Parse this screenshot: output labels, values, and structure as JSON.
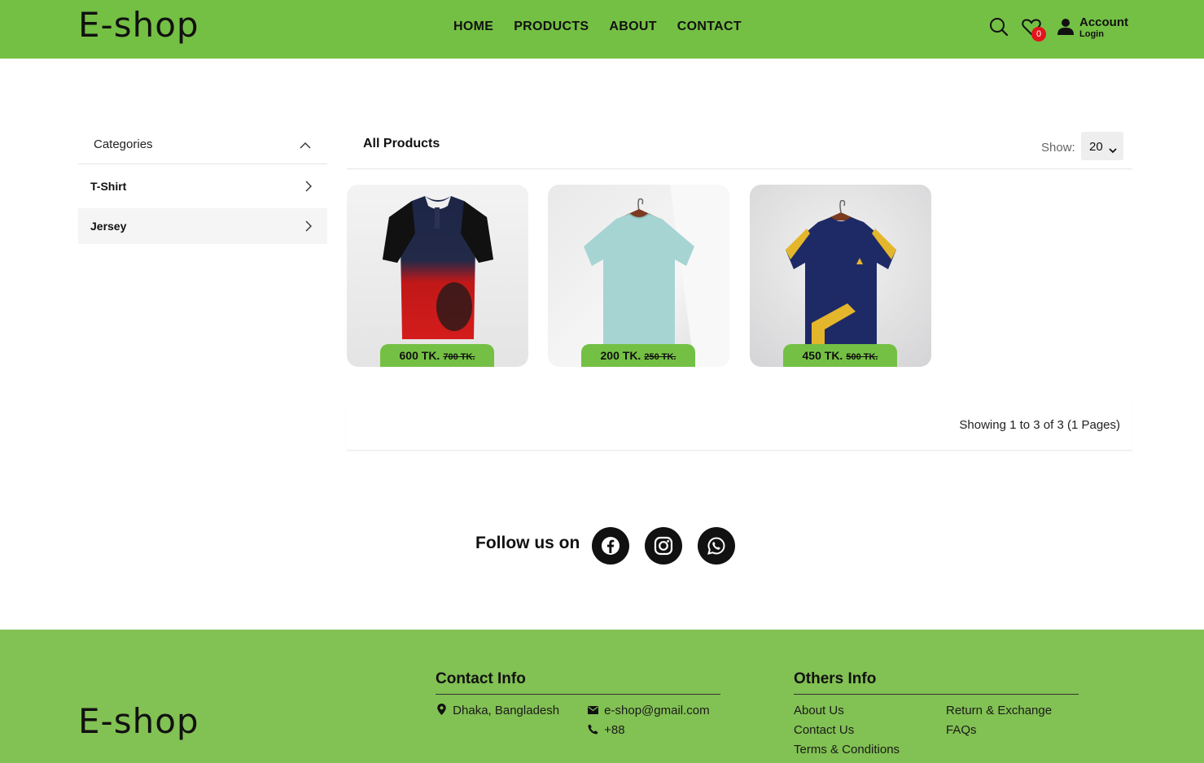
{
  "header": {
    "logo": "E-shop",
    "nav": [
      "HOME",
      "PRODUCTS",
      "ABOUT",
      "CONTACT"
    ],
    "wishlist_count": "0",
    "account_label": "Account",
    "account_sub": "Login",
    "accent_color": "#74c044"
  },
  "sidebar": {
    "title": "Categories",
    "items": [
      {
        "label": "T-Shirt"
      },
      {
        "label": "Jersey"
      }
    ]
  },
  "products": {
    "title": "All Products",
    "show_label": "Show:",
    "show_value": "20",
    "items": [
      {
        "price": "600 TK.",
        "old_price": "700 TK.",
        "image": "red-black-jersey"
      },
      {
        "price": "200 TK.",
        "old_price": "250 TK.",
        "image": "mint-tshirt"
      },
      {
        "price": "450 TK.",
        "old_price": "500 TK.",
        "image": "navy-yellow-tshirt"
      }
    ],
    "pagination_text": "Showing 1 to 3 of 3 (1 Pages)"
  },
  "follow": {
    "label": "Follow us on",
    "icons": [
      "facebook-icon",
      "instagram-icon",
      "whatsapp-icon"
    ]
  },
  "footer": {
    "logo": "E-shop",
    "contact_title": "Contact Info",
    "address": "Dhaka, Bangladesh",
    "email": "e-shop@gmail.com",
    "phone": "+88",
    "others_title": "Others Info",
    "links": [
      "About Us",
      "Contact Us",
      "Terms & Conditions",
      "Return & Exchange",
      "FAQs"
    ],
    "bg_color": "#82c153"
  }
}
